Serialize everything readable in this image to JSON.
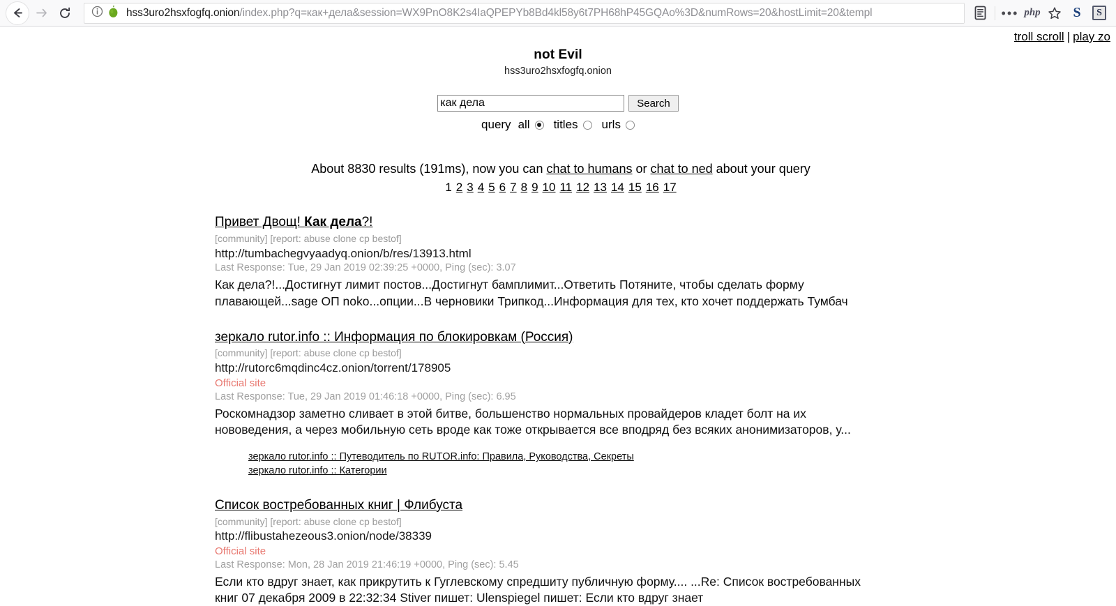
{
  "browser": {
    "back_label": "Back",
    "forward_label": "Forward",
    "reload_label": "Reload",
    "url_domain": "hss3uro2hsxfogfq.onion",
    "url_rest": "/index.php?q=как+дела&session=WX9PnO8K2s4IaQPEPYb8Bd4kl58y6t7PH68hP45GQAo%3D&numRows=20&hostLimit=20&templ",
    "icons": {
      "info": "info-icon",
      "onion": "onion-icon",
      "reader": "reader-view-icon",
      "dots": "more-actions-icon",
      "php": "php",
      "bookmark": "star-icon",
      "ext_s1": "S",
      "ext_s2": "S"
    }
  },
  "page_top_links": {
    "troll_scroll": "troll scroll",
    "separator": "|",
    "play_zone": "play zo"
  },
  "site": {
    "title": "not Evil",
    "domain": "hss3uro2hsxfogfq.onion"
  },
  "search": {
    "value": "как дела",
    "placeholder": "",
    "button_label": "Search",
    "scope_label": "query",
    "options": [
      {
        "label": "all",
        "checked": true
      },
      {
        "label": "titles",
        "checked": false
      },
      {
        "label": "urls",
        "checked": false
      }
    ]
  },
  "summary": {
    "prefix": "About 8830 results (191ms), now you can ",
    "link_humans": "chat to humans",
    "middle": " or ",
    "link_ned": "chat to ned",
    "suffix": " about your query"
  },
  "pagination": {
    "current": "1",
    "pages": [
      "1",
      "2",
      "3",
      "4",
      "5",
      "6",
      "7",
      "8",
      "9",
      "10",
      "11",
      "12",
      "13",
      "14",
      "15",
      "16",
      "17"
    ]
  },
  "results": [
    {
      "title_prefix": "Привет Двощ! ",
      "title_bold": "Как дела",
      "title_suffix": "?!",
      "tags": "[community] [report: abuse clone cp bestof]",
      "url": "http://tumbachegvyaadyq.onion/b/res/13913.html",
      "official": "",
      "meta": "Last Response: Tue, 29 Jan 2019 02:39:25 +0000, Ping (sec): 3.07",
      "snippet": "Как дела?!...Достигнут лимит постов...Достигнут бамплимит...Ответить Потяните, чтобы сделать форму плавающей...sage ОП noko...опции...В черновики Трипкод...Информация для тех, кто хочет поддержать Тумбач",
      "sublinks": []
    },
    {
      "title_prefix": "зеркало rutor.info :: Информация по блокировкам (Россия)",
      "title_bold": "",
      "title_suffix": "",
      "tags": "[community] [report: abuse clone cp bestof]",
      "url": "http://rutorc6mqdinc4cz.onion/torrent/178905",
      "official": "Official site",
      "meta": "Last Response: Tue, 29 Jan 2019 01:46:18 +0000, Ping (sec): 6.95",
      "snippet": "Роскомнадзор заметно сливает в этой битве, большенство нормальных провайдеров кладет болт на их нововедения, а через мобильную сеть вроде как тоже открывается все вподряд без всяких анонимизаторов, у...",
      "sublinks": [
        "зеркало rutor.info :: Путеводитель по RUTOR.info: Правила, Руководства, Секреты",
        "зеркало rutor.info :: Категории"
      ]
    },
    {
      "title_prefix": "Список востребованных книг | Флибуста",
      "title_bold": "",
      "title_suffix": "",
      "tags": "[community] [report: abuse clone cp bestof]",
      "url": "http://flibustahezeous3.onion/node/38339",
      "official": "Official site",
      "meta": "Last Response: Mon, 28 Jan 2019 21:46:19 +0000, Ping (sec): 5.45",
      "snippet": "Если кто вдруг знает, как прикрутить к Гуглевскому спредшиту публичную форму.... ...Re: Список востребованных книг  07 декабря 2009  в 22:32:34 Stiver пишет:   Ulenspiegel пишет:   Если кто вдруг знает",
      "sublinks": []
    }
  ],
  "colors": {
    "official_site": "#e8776f",
    "meta_grey": "#a0a0a0",
    "onion_green": "#6aa81e"
  }
}
